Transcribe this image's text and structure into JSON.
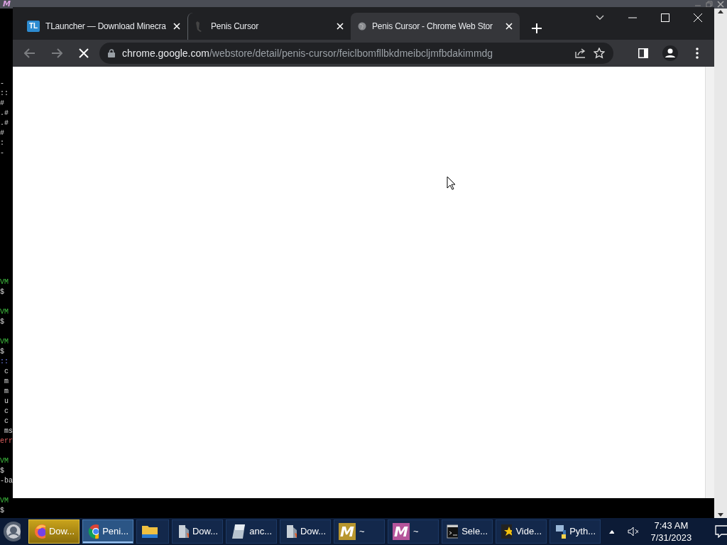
{
  "terminal": {
    "logo": "M",
    "lines": [
      {
        "kind": "text",
        "text": "-"
      },
      {
        "kind": "text",
        "text": "::"
      },
      {
        "kind": "text",
        "text": "#"
      },
      {
        "kind": "text",
        "text": ".#"
      },
      {
        "kind": "text",
        "text": ".#"
      },
      {
        "kind": "text",
        "text": "#"
      },
      {
        "kind": "text",
        "text": ":"
      },
      {
        "kind": "text",
        "text": "-"
      },
      {
        "kind": "blank"
      },
      {
        "kind": "blank"
      },
      {
        "kind": "blank"
      },
      {
        "kind": "blank"
      },
      {
        "kind": "blank"
      },
      {
        "kind": "blank"
      },
      {
        "kind": "blank"
      },
      {
        "kind": "blank"
      },
      {
        "kind": "blank"
      },
      {
        "kind": "blank"
      },
      {
        "kind": "blank"
      },
      {
        "kind": "blank"
      },
      {
        "kind": "prompt",
        "text": "VM"
      },
      {
        "kind": "text",
        "text": "$"
      },
      {
        "kind": "blank"
      },
      {
        "kind": "prompt",
        "text": "VM"
      },
      {
        "kind": "text",
        "text": "$"
      },
      {
        "kind": "blank"
      },
      {
        "kind": "prompt",
        "text": "VM"
      },
      {
        "kind": "text",
        "text": "$"
      },
      {
        "kind": "info",
        "text": "::"
      },
      {
        "kind": "text",
        "text": " c"
      },
      {
        "kind": "text",
        "text": " m"
      },
      {
        "kind": "text",
        "text": " m"
      },
      {
        "kind": "text",
        "text": " u"
      },
      {
        "kind": "text",
        "text": " c"
      },
      {
        "kind": "text",
        "text": " c"
      },
      {
        "kind": "text",
        "text": " ms"
      },
      {
        "kind": "error",
        "text": "err"
      },
      {
        "kind": "blank"
      },
      {
        "kind": "prompt",
        "text": "VM"
      },
      {
        "kind": "text",
        "text": "$"
      },
      {
        "kind": "text",
        "text": "-ba"
      },
      {
        "kind": "blank"
      },
      {
        "kind": "prompt",
        "text": "VM"
      },
      {
        "kind": "text",
        "text": "$"
      }
    ]
  },
  "browser": {
    "tabs": [
      {
        "badge": "TL",
        "title": "TLauncher — Download Minecra",
        "selected": false
      },
      {
        "title": "Penis Cursor",
        "selected": false
      },
      {
        "title": "Penis Cursor - Chrome Web Stor",
        "selected": true
      }
    ],
    "loading": true,
    "url_host": "chrome.google.com",
    "url_path": "/webstore/detail/penis-cursor/feiclbomfllbkdmeibcljmfbdakimmdg"
  },
  "taskbar": {
    "items": [
      {
        "label": "Dow...",
        "selected": false,
        "flashing": true
      },
      {
        "label": "Peni...",
        "selected": true,
        "flashing": false
      },
      {
        "selected": false,
        "flashing": false
      },
      {
        "label": "Dow...",
        "selected": false,
        "flashing": false
      },
      {
        "label": "anc...",
        "selected": false,
        "flashing": false
      },
      {
        "label": "Dow...",
        "selected": false,
        "flashing": false
      },
      {
        "logo": "M",
        "label": "~",
        "selected": false,
        "flashing": false
      },
      {
        "logo": "M",
        "label": "~",
        "selected": false,
        "flashing": false
      },
      {
        "label": "Sele...",
        "selected": false,
        "flashing": false
      },
      {
        "label": "Vide...",
        "selected": false,
        "flashing": false
      },
      {
        "label": "Pyth...",
        "selected": false,
        "flashing": false
      }
    ],
    "clock": {
      "time": "7:43 AM",
      "date": "7/31/2023"
    }
  }
}
